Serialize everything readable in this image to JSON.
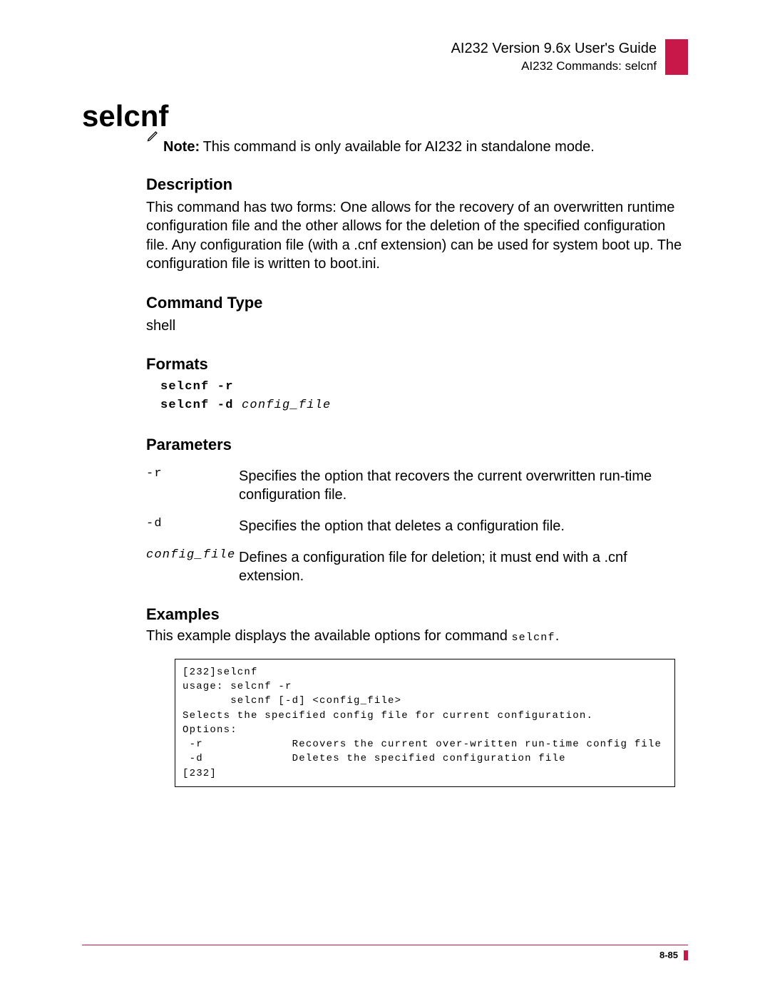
{
  "header": {
    "title": "AI232 Version 9.6x User's Guide",
    "subtitle": "AI232 Commands: selcnf"
  },
  "command_name": "selcnf",
  "note": {
    "label": "Note:",
    "text": "This command is only available for AI232 in standalone mode."
  },
  "sections": {
    "description": {
      "heading": "Description",
      "body": "This command has two forms: One allows for the recovery of an overwritten runtime configuration file and the other allows for the deletion of the specified configuration file. Any configuration file (with a .cnf extension) can be used for system boot up. The configuration file is written to boot.ini."
    },
    "command_type": {
      "heading": "Command Type",
      "body": "shell"
    },
    "formats": {
      "heading": "Formats",
      "line1_bold": "selcnf -r",
      "line2_bold": "selcnf -d",
      "line2_ital": "config_file"
    },
    "parameters": {
      "heading": "Parameters",
      "rows": [
        {
          "name": "-r",
          "ital": false,
          "desc": "Specifies the option that recovers the current overwritten run-time configuration file."
        },
        {
          "name": "-d",
          "ital": false,
          "desc": "Specifies the option that deletes a configuration file."
        },
        {
          "name": "config_file",
          "ital": true,
          "desc": "Defines a configuration file for deletion; it must end with a .cnf extension."
        }
      ]
    },
    "examples": {
      "heading": "Examples",
      "intro_prefix": "This example displays the available options for command ",
      "intro_code": "selcnf",
      "intro_suffix": ".",
      "code": "[232]selcnf\nusage: selcnf -r\n       selcnf [-d] <config_file>\nSelects the specified config file for current configuration.\nOptions:\n -r             Recovers the current over-written run-time config file\n -d             Deletes the specified configuration file\n[232]"
    }
  },
  "footer": {
    "page": "8-85"
  }
}
